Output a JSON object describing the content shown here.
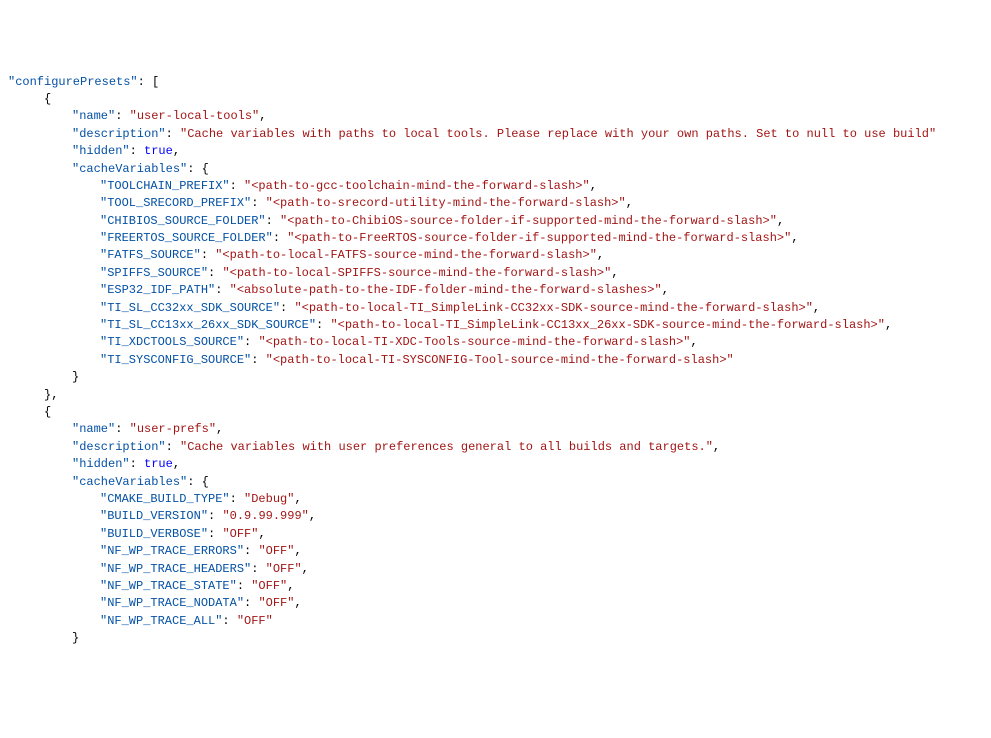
{
  "root_key": "configurePresets",
  "presets": [
    {
      "name_key": "name",
      "name_val": "user-local-tools",
      "desc_key": "description",
      "desc_val": "Cache variables with paths to local tools. Please replace with your own paths. Set to null to use build",
      "hidden_key": "hidden",
      "hidden_val": "true",
      "cache_key": "cacheVariables",
      "vars": [
        {
          "k": "TOOLCHAIN_PREFIX",
          "v": "<path-to-gcc-toolchain-mind-the-forward-slash>"
        },
        {
          "k": "TOOL_SRECORD_PREFIX",
          "v": "<path-to-srecord-utility-mind-the-forward-slash>"
        },
        {
          "k": "CHIBIOS_SOURCE_FOLDER",
          "v": "<path-to-ChibiOS-source-folder-if-supported-mind-the-forward-slash>"
        },
        {
          "k": "FREERTOS_SOURCE_FOLDER",
          "v": "<path-to-FreeRTOS-source-folder-if-supported-mind-the-forward-slash>"
        },
        {
          "k": "FATFS_SOURCE",
          "v": "<path-to-local-FATFS-source-mind-the-forward-slash>"
        },
        {
          "k": "SPIFFS_SOURCE",
          "v": "<path-to-local-SPIFFS-source-mind-the-forward-slash>"
        },
        {
          "k": "ESP32_IDF_PATH",
          "v": "<absolute-path-to-the-IDF-folder-mind-the-forward-slashes>"
        },
        {
          "k": "TI_SL_CC32xx_SDK_SOURCE",
          "v": "<path-to-local-TI_SimpleLink-CC32xx-SDK-source-mind-the-forward-slash>"
        },
        {
          "k": "TI_SL_CC13xx_26xx_SDK_SOURCE",
          "v": "<path-to-local-TI_SimpleLink-CC13xx_26xx-SDK-source-mind-the-forward-slash>"
        },
        {
          "k": "TI_XDCTOOLS_SOURCE",
          "v": "<path-to-local-TI-XDC-Tools-source-mind-the-forward-slash>"
        },
        {
          "k": "TI_SYSCONFIG_SOURCE",
          "v": "<path-to-local-TI-SYSCONFIG-Tool-source-mind-the-forward-slash>"
        }
      ]
    },
    {
      "name_key": "name",
      "name_val": "user-prefs",
      "desc_key": "description",
      "desc_val": "Cache variables with user preferences general to all builds and targets.",
      "hidden_key": "hidden",
      "hidden_val": "true",
      "cache_key": "cacheVariables",
      "vars": [
        {
          "k": "CMAKE_BUILD_TYPE",
          "v": "Debug"
        },
        {
          "k": "BUILD_VERSION",
          "v": "0.9.99.999"
        },
        {
          "k": "BUILD_VERBOSE",
          "v": "OFF"
        },
        {
          "k": "NF_WP_TRACE_ERRORS",
          "v": "OFF"
        },
        {
          "k": "NF_WP_TRACE_HEADERS",
          "v": "OFF"
        },
        {
          "k": "NF_WP_TRACE_STATE",
          "v": "OFF"
        },
        {
          "k": "NF_WP_TRACE_NODATA",
          "v": "OFF"
        },
        {
          "k": "NF_WP_TRACE_ALL",
          "v": "OFF"
        }
      ]
    }
  ]
}
